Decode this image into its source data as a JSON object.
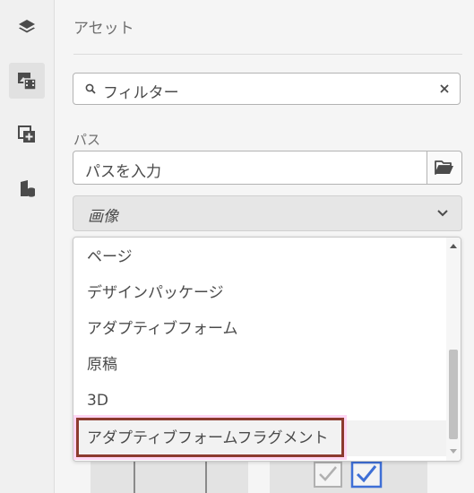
{
  "panel": {
    "title": "アセット",
    "search_placeholder": "フィルター",
    "path_label": "パス",
    "path_placeholder": "パスを入力",
    "type_select_value": "画像"
  },
  "rail": {
    "items": [
      {
        "icon": "layers-icon",
        "active": false
      },
      {
        "icon": "assets-icon",
        "active": true
      },
      {
        "icon": "add-component-icon",
        "active": false
      },
      {
        "icon": "content-tree-icon",
        "active": false
      }
    ]
  },
  "dropdown": {
    "options": [
      "ページ",
      "デザインパッケージ",
      "アダプティブフォーム",
      "原稿",
      "3D",
      "アダプティブフォームフラグメント"
    ],
    "selected_index": 5
  },
  "colors": {
    "selection_outline": "#8c3a2e",
    "selection_glow": "#ffd6f4",
    "checkbox_checked": "#3e6fd6"
  }
}
